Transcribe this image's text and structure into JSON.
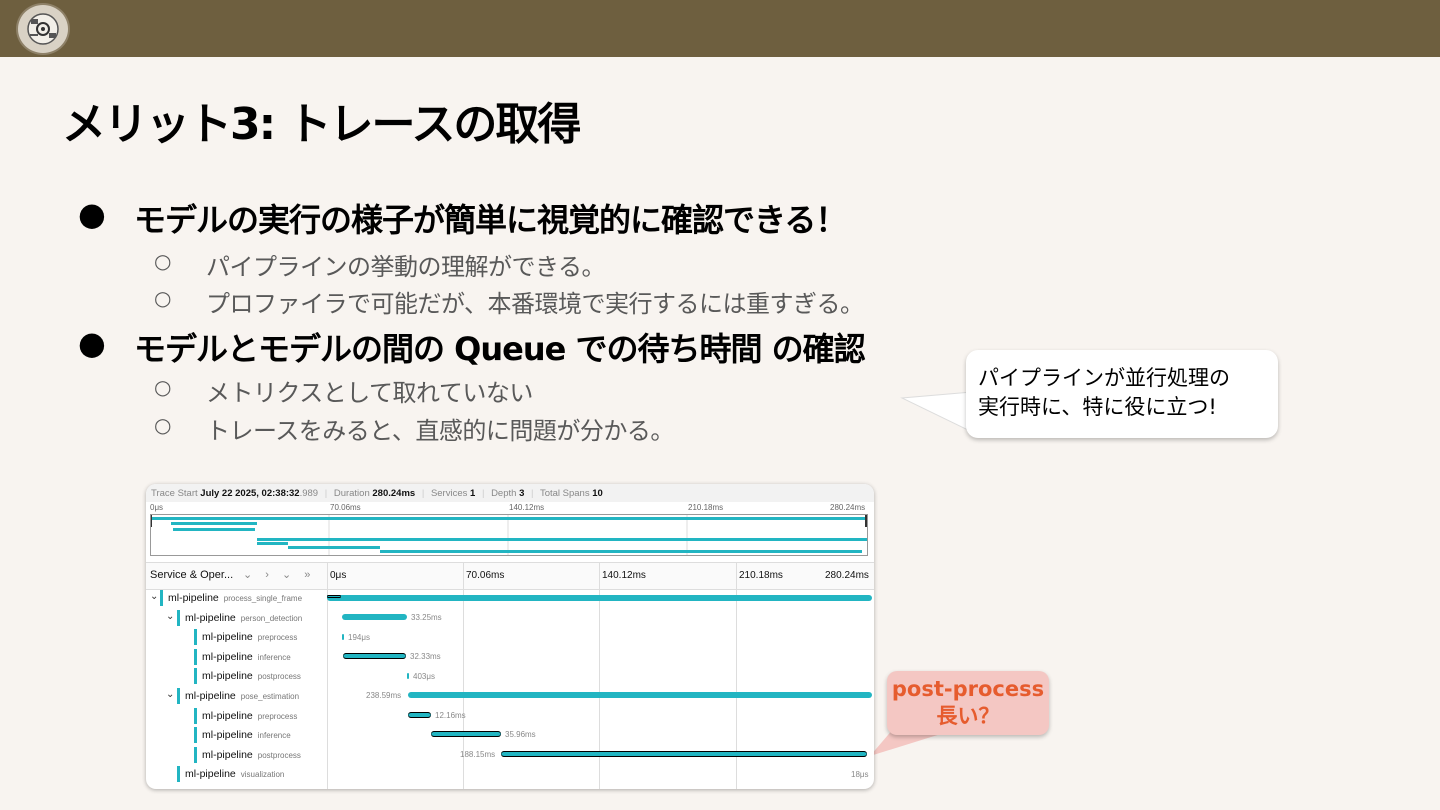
{
  "slide": {
    "title": "メリット3: トレースの取得",
    "bullets": [
      {
        "text": "モデルの実行の様子が簡単に視覚的に確認できる！",
        "dot": "●",
        "subs": [
          "パイプラインの挙動の理解ができる。",
          "プロファイラで可能だが、本番環境で実行するには重すぎる。"
        ]
      },
      {
        "text": "モデルとモデルの間の  Queue での待ち時間  の確認",
        "dot": "●",
        "subs": [
          "メトリクスとして取れていない",
          "トレースをみると、直感的に問題が分かる。"
        ]
      }
    ],
    "sub_dot": "○",
    "callout": {
      "line1": "パイプラインが並行処理の",
      "line2": "実行時に、特に役に立つ!"
    },
    "red_callout": {
      "line1": "post-process",
      "line2": "長い？"
    }
  },
  "trace": {
    "header": {
      "trace_start_label": "Trace Start",
      "trace_start_value": "July 22 2025, 02:38:32",
      "trace_start_ms": ".989",
      "duration_label": "Duration",
      "duration_value": "280.24ms",
      "services_label": "Services",
      "services_value": "1",
      "depth_label": "Depth",
      "depth_value": "3",
      "total_spans_label": "Total Spans",
      "total_spans_value": "10"
    },
    "ticks": [
      "0μs",
      "70.06ms",
      "140.12ms",
      "210.18ms",
      "280.24ms"
    ],
    "column_label": "Service & Oper...",
    "column_icons": "⌄ › ⌄ »",
    "spans": [
      {
        "service": "ml-pipeline",
        "op": "process_single_frame",
        "label": ""
      },
      {
        "service": "ml-pipeline",
        "op": "person_detection",
        "label": "33.25ms"
      },
      {
        "service": "ml-pipeline",
        "op": "preprocess",
        "label": "194μs"
      },
      {
        "service": "ml-pipeline",
        "op": "inference",
        "label": "32.33ms"
      },
      {
        "service": "ml-pipeline",
        "op": "postprocess",
        "label": "403μs"
      },
      {
        "service": "ml-pipeline",
        "op": "pose_estimation",
        "label": "238.59ms"
      },
      {
        "service": "ml-pipeline",
        "op": "preprocess",
        "label": "12.16ms"
      },
      {
        "service": "ml-pipeline",
        "op": "inference",
        "label": "35.96ms"
      },
      {
        "service": "ml-pipeline",
        "op": "postprocess",
        "label": "188.15ms"
      },
      {
        "service": "ml-pipeline",
        "op": "visualization",
        "label": "18μs"
      }
    ]
  },
  "colors": {
    "topbar": "#6e5f3f",
    "span": "#22b5c2",
    "red_text": "#e65c2e",
    "red_bg": "#f4c7c3"
  }
}
